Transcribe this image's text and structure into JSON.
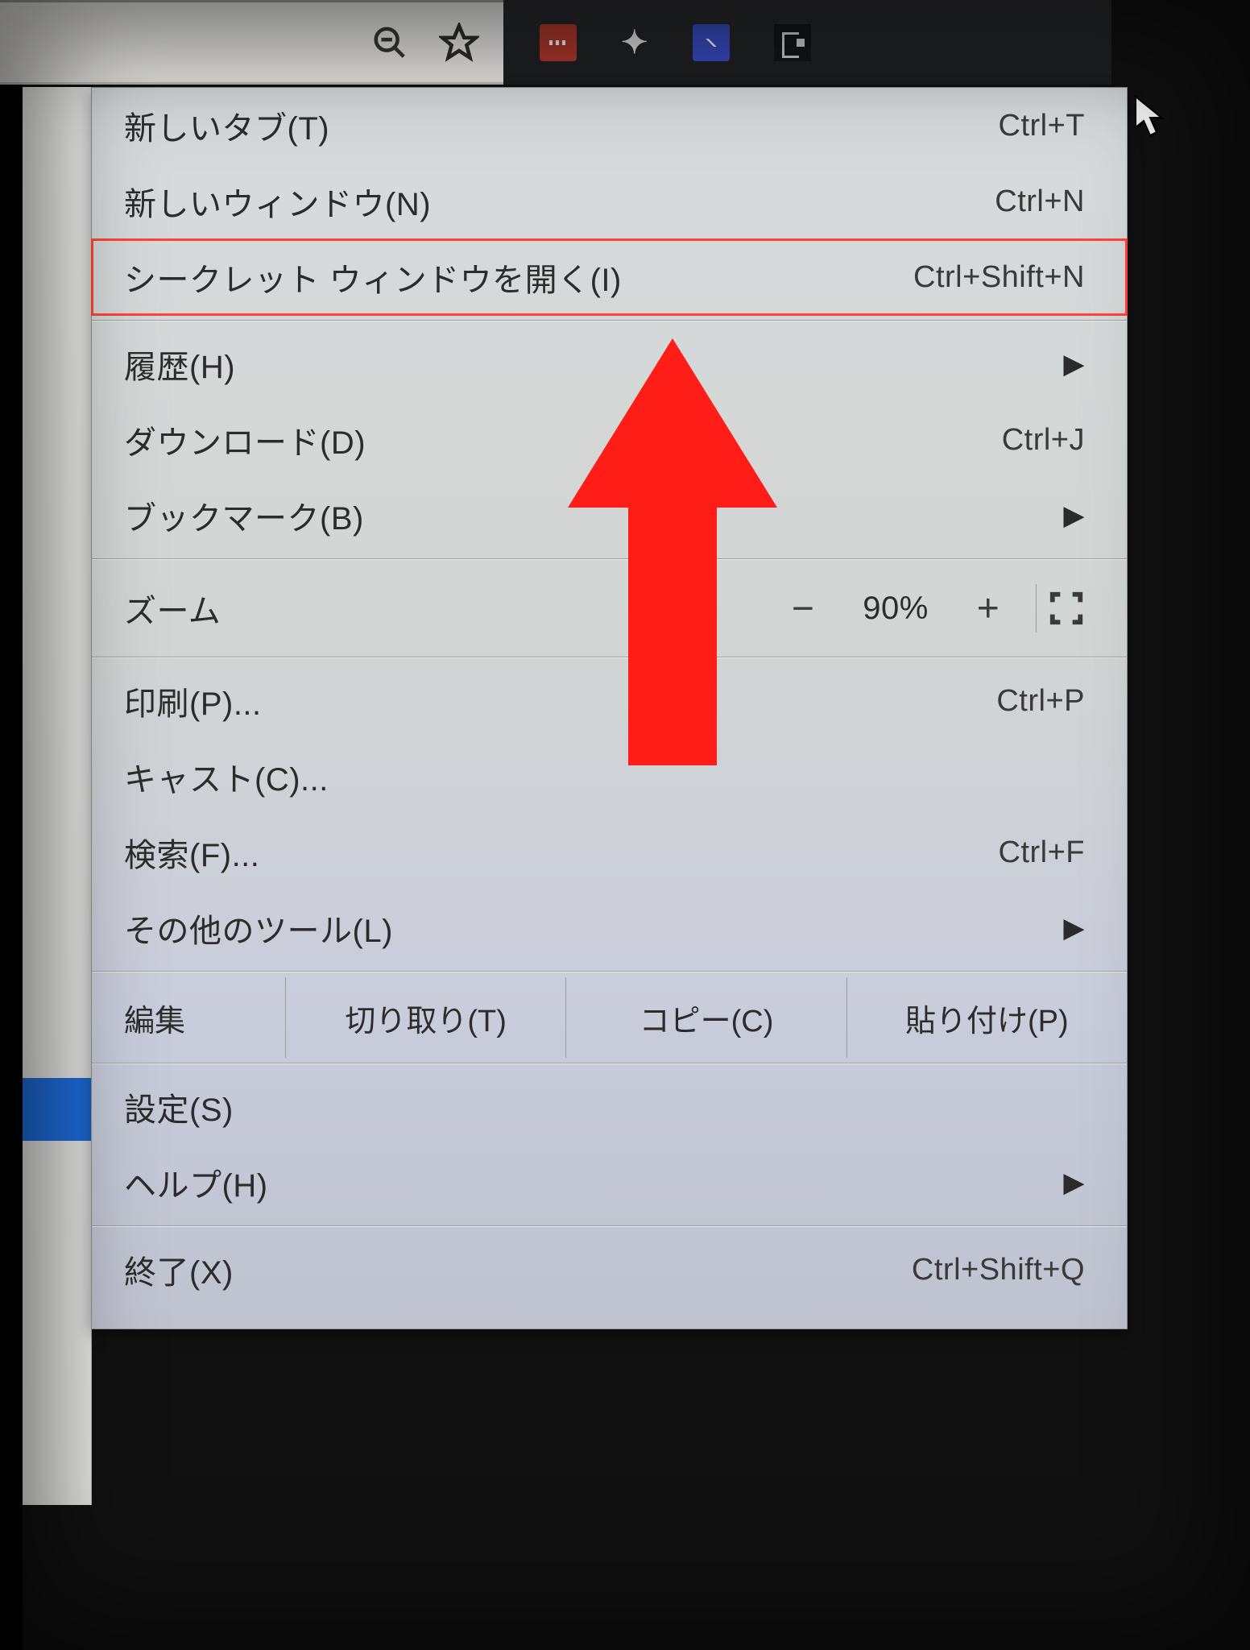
{
  "menu": {
    "new_tab": {
      "label": "新しいタブ(T)",
      "shortcut": "Ctrl+T"
    },
    "new_window": {
      "label": "新しいウィンドウ(N)",
      "shortcut": "Ctrl+N"
    },
    "incognito": {
      "label": "シークレット ウィンドウを開く(I)",
      "shortcut": "Ctrl+Shift+N"
    },
    "history": {
      "label": "履歴(H)"
    },
    "downloads": {
      "label": "ダウンロード(D)",
      "shortcut": "Ctrl+J"
    },
    "bookmarks": {
      "label": "ブックマーク(B)"
    },
    "zoom": {
      "label": "ズーム",
      "value": "90%",
      "minus": "−",
      "plus": "+"
    },
    "print": {
      "label": "印刷(P)...",
      "shortcut": "Ctrl+P"
    },
    "cast": {
      "label": "キャスト(C)..."
    },
    "find": {
      "label": "検索(F)...",
      "shortcut": "Ctrl+F"
    },
    "more_tools": {
      "label": "その他のツール(L)"
    },
    "edit": {
      "label": "編集",
      "cut": "切り取り(T)",
      "copy": "コピー(C)",
      "paste": "貼り付け(P)"
    },
    "settings": {
      "label": "設定(S)"
    },
    "help": {
      "label": "ヘルプ(H)"
    },
    "exit": {
      "label": "終了(X)",
      "shortcut": "Ctrl+Shift+Q"
    }
  }
}
